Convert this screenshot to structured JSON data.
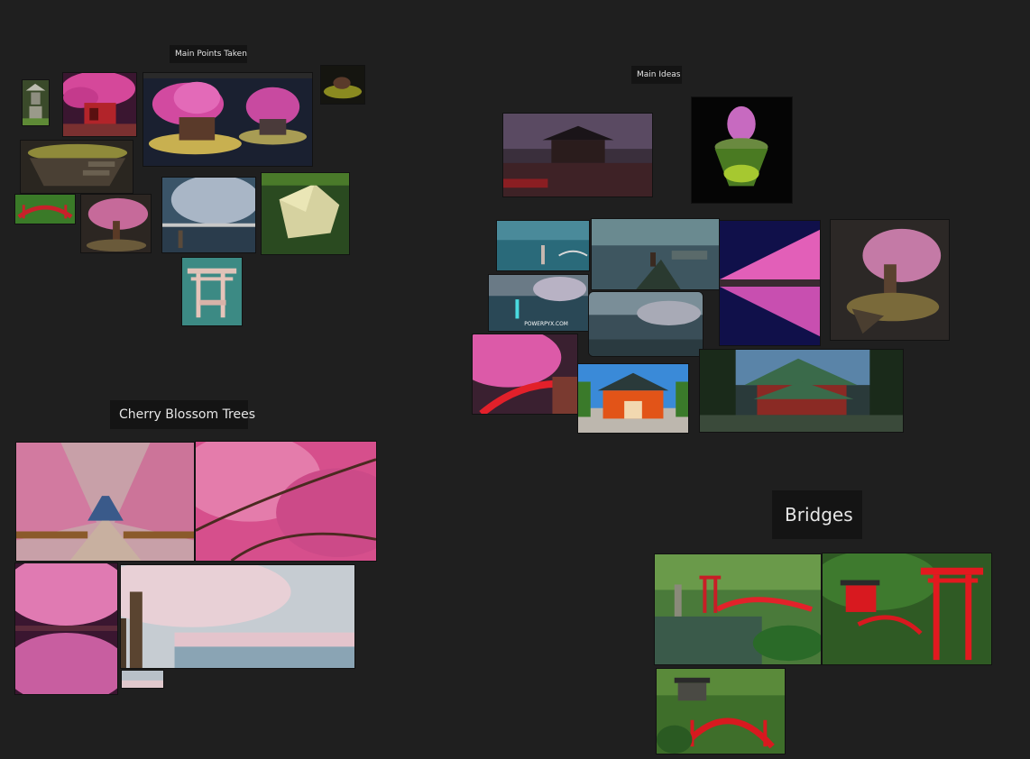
{
  "board": {
    "groups": [
      {
        "id": "main-points",
        "title": "Main Points Taken"
      },
      {
        "id": "main-ideas",
        "title": "Main Ideas"
      },
      {
        "id": "cherry",
        "title": "Cherry Blossom Trees"
      },
      {
        "id": "bridges",
        "title": "Bridges"
      }
    ]
  },
  "thumbnails": {
    "overlay_watermark": "POWERPYX.COM"
  },
  "colors": {
    "background": "#1f1f1f",
    "label_background": "#141414",
    "label_text": "#e6e6e6",
    "blossom_pink": "#e06aa8",
    "bridge_red": "#d8191f"
  }
}
